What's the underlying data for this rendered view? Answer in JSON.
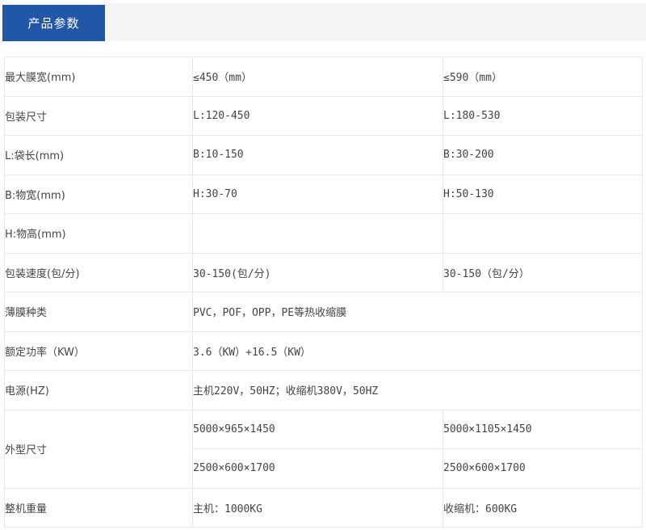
{
  "header": {
    "tab_label": "产品参数",
    "tab_color": "#2257a8",
    "bar_color": "#f5f5f6"
  },
  "table": {
    "border_color": "#e8e8e8",
    "dark_divider_color": "#606060",
    "rows": [
      {
        "label": "最大膜宽(mm)",
        "col2": "≤450（mm）",
        "col3": "≤590（mm）"
      },
      {
        "label": "包装尺寸",
        "col2": "L:120-450",
        "col3": "L:180-530"
      },
      {
        "label": "L:袋长(mm)",
        "col2": "B:10-150",
        "col3": "B:30-200"
      },
      {
        "label": "B:物宽(mm)",
        "col2": "H:30-70",
        "col3": "H:50-130"
      },
      {
        "label": "H:物高(mm)",
        "col2": "",
        "col3": ""
      },
      {
        "label": "包装速度(包/分)",
        "col2": "30-150(包/分)",
        "col3": "30-150（包/分）"
      },
      {
        "label": "薄膜种类",
        "span": "PVC，POF，OPP，PE等热收缩膜"
      },
      {
        "label": "额定功率（KW）",
        "span": "3.6（KW）+16.5（KW）"
      },
      {
        "label": "电源(HZ)",
        "span": "主机220V，50HZ；收缩机380V，50HZ"
      },
      {
        "label": "外型尺寸",
        "col2_top": "5000×965×1450",
        "col3_top": "5000×1105×1450",
        "col2_bottom": "2500×600×1700",
        "col3_bottom": "2500×600×1700"
      },
      {
        "label": "整机重量",
        "col2": "主机：1000KG",
        "col3": "收缩机：600KG"
      }
    ]
  }
}
